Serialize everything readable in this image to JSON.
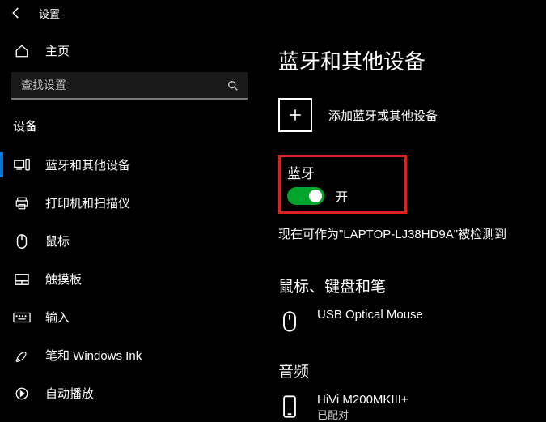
{
  "app": {
    "title": "设置"
  },
  "sidebar": {
    "home": "主页",
    "searchPlaceholder": "查找设置",
    "section": "设备",
    "items": [
      {
        "label": "蓝牙和其他设备"
      },
      {
        "label": "打印机和扫描仪"
      },
      {
        "label": "鼠标"
      },
      {
        "label": "触摸板"
      },
      {
        "label": "输入"
      },
      {
        "label": "笔和 Windows Ink"
      },
      {
        "label": "自动播放"
      }
    ]
  },
  "content": {
    "title": "蓝牙和其他设备",
    "addDevice": "添加蓝牙或其他设备",
    "bluetooth": {
      "heading": "蓝牙",
      "state": "开"
    },
    "discoverable": "现在可作为\"LAPTOP-LJ38HD9A\"被检测到",
    "categories": [
      {
        "heading": "鼠标、键盘和笔",
        "devices": [
          {
            "name": "USB Optical Mouse",
            "sub": ""
          }
        ]
      },
      {
        "heading": "音频",
        "devices": [
          {
            "name": "HiVi M200MKIII+",
            "sub": "已配对"
          }
        ]
      }
    ]
  }
}
